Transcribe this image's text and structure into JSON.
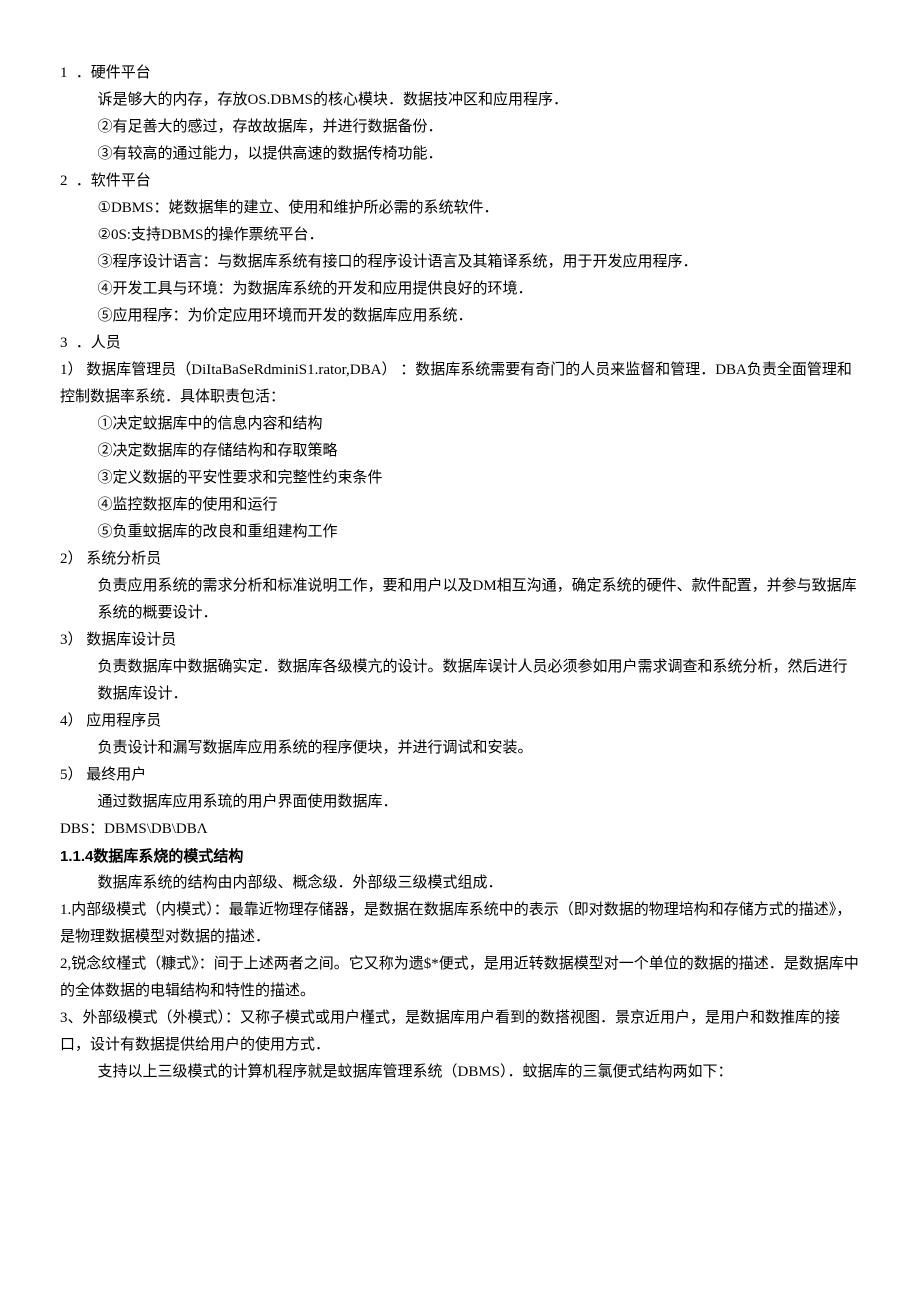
{
  "s1": {
    "h": "1 ．硬件平台",
    "p1": "诉是够大的内存，存放OS.DBMS的核心模块．数据技冲区和应用程序．",
    "p2": "②有足善大的感过，存故故据库，并进行数据备份．",
    "p3": "③有较高的通过能力，以提供高速的数据传椅功能．"
  },
  "s2": {
    "h": "2 ．软件平台",
    "p1": "①DBMS：姥数据隼的建立、使用和维护所必需的系统软件．",
    "p2": "②0S:支持DBMS的操作票统平台．",
    "p3": "③程序设计语言：与数据库系统有接口的程序设计语言及其箱译系统，用于开发应用程序．",
    "p4": "④开发工具与环境：为数据库系统的开发和应用提供良好的环境．",
    "p5": "⑤应用程序：为价定应用环境而开发的数据库应用系统．"
  },
  "s3": {
    "h": "3 ．人员",
    "p1": "1） 数据库管理员（DiItaBaSeRdminiS1.rator,DBA） ：数据库系统需要有奇门的人员来监督和管理．DBA负责全面管理和控制数据率系统．具体职责包活：",
    "p2": "①决定蚊据库中的信息内容和结构",
    "p3": "②决定数据库的存储结构和存取策略",
    "p4": "③定义数据的平安性要求和完整性约束条件",
    "p5": "④监控数抠库的使用和运行",
    "p6": "⑤负重蚊据库的改良和重组建构工作",
    "h4": "2） 系统分析员",
    "p7": "负责应用系统的需求分析和标准说明工作，要和用户以及DM相互沟通，确定系统的硬件、款件配置，并参与致据库系统的概要设计．",
    "h5": "3） 数据库设计员",
    "p8": "负责数据库中数据确实定．数据库各级模亢的设计。数据库误计人员必须参如用户需求调查和系统分析，然后进行数据库设计．",
    "h6": "4） 应用程序员",
    "p9": "负责设计和漏写数据库应用系统的程序便块，并进行调试和安装。",
    "h7": "5） 最终用户",
    "p10": "通过数据库应用系琉的用户界面使用数据库．",
    "p11": "DBS：DBMS\\DB\\DBΛ"
  },
  "s4": {
    "h": "1.1.4数据库系烧的模式结构",
    "p1": "数据库系统的结构由内部级、概念级．外部级三级模式组成．",
    "p2": "1.内部级模式（内模式）：最靠近物理存储器，是数据在数据库系统中的表示（即对数据的物理培构和存储方式的描述》，是物理数据模型对数据的描述．",
    "p3": "2,锐念纹槿式（糠式》：间于上述两者之间。它又称为遗$*便式，是用近转数据模型对一个单位的数据的描述．是数据库中的全体数据的电辑结构和特性的描述。",
    "p4": "3、外部级模式（外模式）：又称子模式或用户槿式，是数据库用户看到的数搭视图．景京近用户，是用户和数推库的接口，设计有数据提供给用户的使用方式．",
    "p5": "支持以上三级模式的计算机程序就是蚊据库管理系统（DBMS）．蚊据库的三氯便式结构两如下："
  }
}
